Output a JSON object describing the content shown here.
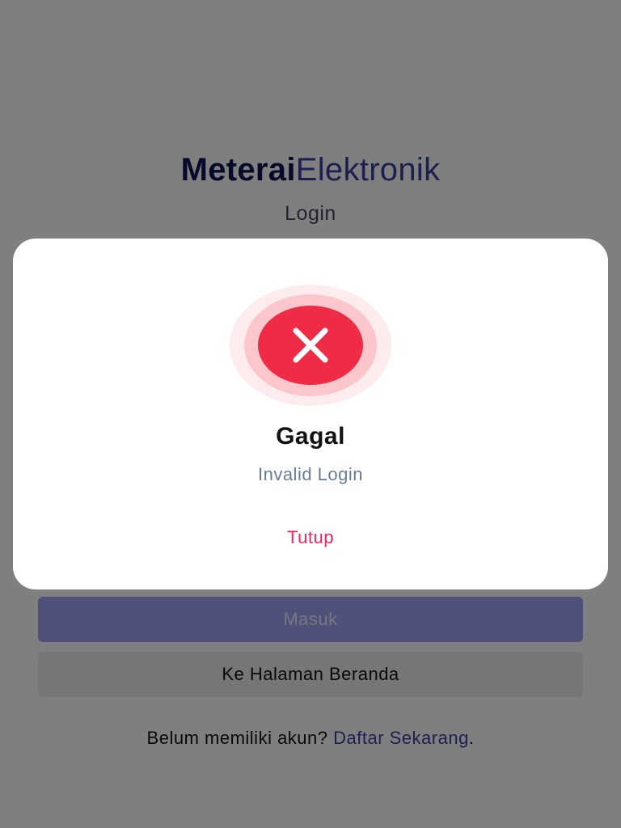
{
  "brand": {
    "bold_part": "Meterai",
    "light_part": "Elektronik"
  },
  "page": {
    "title": "Login"
  },
  "buttons": {
    "submit_label": "Masuk",
    "home_label": "Ke Halaman Beranda"
  },
  "register": {
    "prompt": "Belum memiliki akun? ",
    "link_label": "Daftar Sekarang",
    "suffix": "."
  },
  "dialog": {
    "icon": "close-x-icon",
    "title": "Gagal",
    "message": "Invalid Login",
    "close_label": "Tutup"
  },
  "colors": {
    "brand_dark": "#0d1252",
    "brand_accent": "#3b3fa0",
    "error_red": "#ef2b46",
    "close_pink": "#f1245d",
    "overlay": "rgba(0,0,0,0.5)"
  }
}
